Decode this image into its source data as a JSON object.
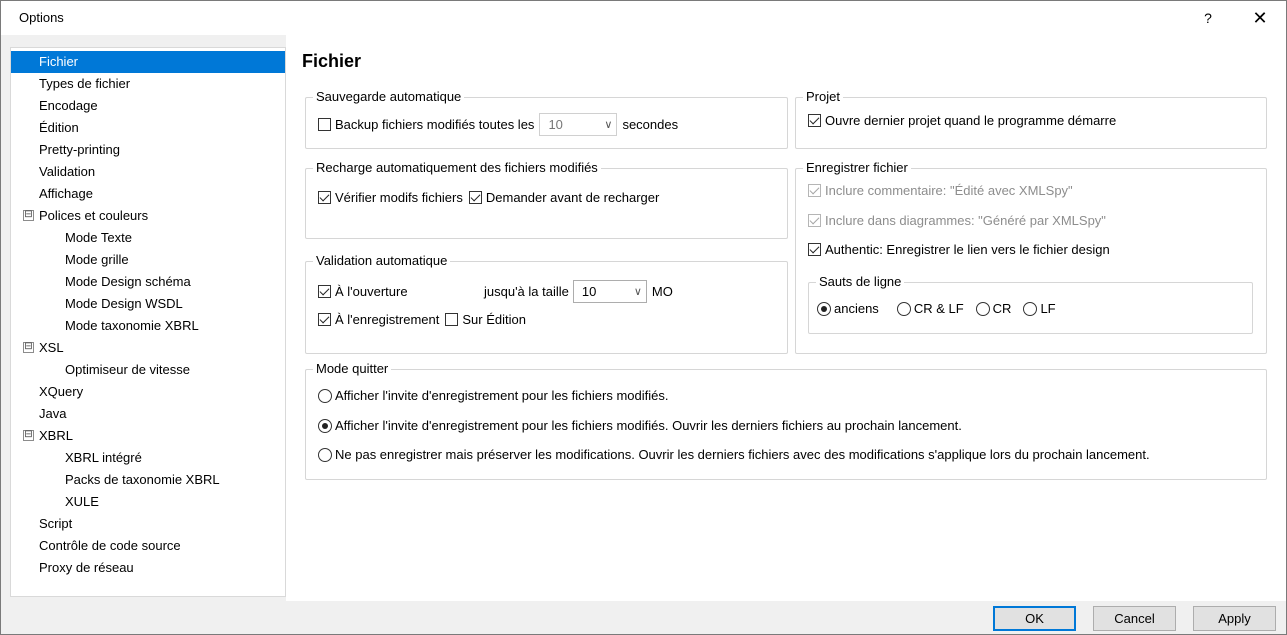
{
  "window": {
    "title": "Options",
    "help": "?",
    "close": "✕"
  },
  "tree": {
    "items": [
      {
        "label": "Fichier"
      },
      {
        "label": "Types de fichier"
      },
      {
        "label": "Encodage"
      },
      {
        "label": "Édition"
      },
      {
        "label": "Pretty-printing"
      },
      {
        "label": "Validation"
      },
      {
        "label": "Affichage"
      },
      {
        "label": "Polices et couleurs",
        "expander": "⊟"
      },
      {
        "label": "Mode Texte"
      },
      {
        "label": "Mode grille"
      },
      {
        "label": "Mode Design schéma"
      },
      {
        "label": "Mode Design WSDL"
      },
      {
        "label": "Mode taxonomie XBRL"
      },
      {
        "label": "XSL",
        "expander": "⊟"
      },
      {
        "label": "Optimiseur de vitesse"
      },
      {
        "label": "XQuery"
      },
      {
        "label": "Java"
      },
      {
        "label": "XBRL",
        "expander": "⊟"
      },
      {
        "label": "XBRL intégré"
      },
      {
        "label": "Packs de taxonomie XBRL"
      },
      {
        "label": "XULE"
      },
      {
        "label": "Script"
      },
      {
        "label": "Contrôle de code source"
      },
      {
        "label": "Proxy de réseau"
      }
    ]
  },
  "page": {
    "title": "Fichier"
  },
  "autosave": {
    "title": "Sauvegarde automatique",
    "backup_label": "Backup fichiers modifiés toutes les",
    "interval_value": "10",
    "seconds_label": "secondes"
  },
  "reload": {
    "title": "Recharge automatiquement des fichiers modifiés",
    "check_label": "Vérifier modifs fichiers",
    "ask_label": "Demander avant de recharger"
  },
  "validation": {
    "title": "Validation automatique",
    "on_open_label": "À l'ouverture",
    "size_label": "jusqu'à la taille",
    "size_value": "10",
    "size_unit": "MO",
    "on_save_label": "À l'enregistrement",
    "on_edit_label": "Sur Édition"
  },
  "project": {
    "title": "Projet",
    "open_last_label": "Ouvre dernier projet quand le programme démarre"
  },
  "save_file": {
    "title": "Enregistrer fichier",
    "comment_label": "Inclure commentaire: \"Édité avec XMLSpy\"",
    "diagrams_label": "Inclure dans diagrammes: \"Généré par XMLSpy\"",
    "authentic_label": "Authentic: Enregistrer le lien vers le fichier design",
    "line_breaks": {
      "title": "Sauts de ligne",
      "options": [
        "anciens",
        "CR & LF",
        "CR",
        "LF"
      ]
    }
  },
  "exit_mode": {
    "title": "Mode quitter",
    "options": [
      "Afficher l'invite d'enregistrement pour les fichiers modifiés.",
      "Afficher l'invite d'enregistrement pour les fichiers modifiés. Ouvrir les derniers fichiers au prochain lancement.",
      "Ne pas enregistrer mais préserver les modifications. Ouvrir les derniers fichiers avec des modifications s'applique lors du prochain lancement."
    ]
  },
  "buttons": {
    "ok": "OK",
    "cancel": "Cancel",
    "apply": "Apply"
  }
}
